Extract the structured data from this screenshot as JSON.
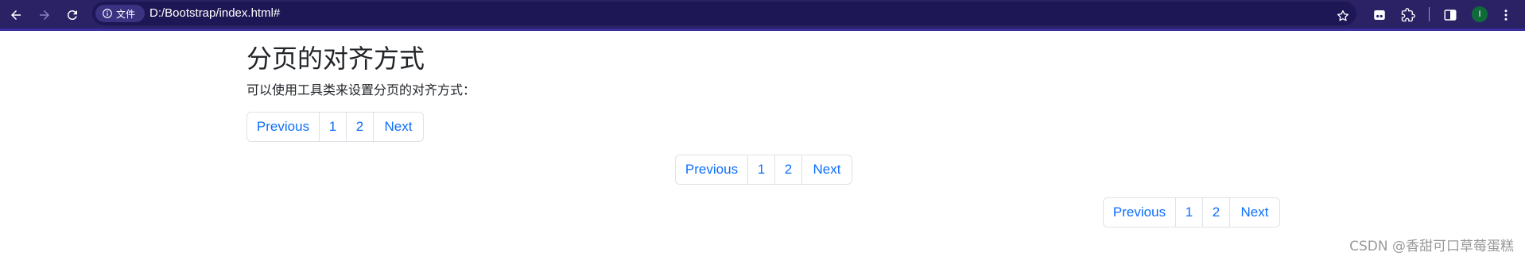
{
  "browser": {
    "site_chip_label": "文件",
    "url": "D:/Bootstrap/index.html#",
    "profile_initial": "I"
  },
  "page": {
    "title": "分页的对齐方式",
    "description": "可以使用工具类来设置分页的对齐方式："
  },
  "paginations": [
    {
      "alignment": "start",
      "items": [
        "Previous",
        "1",
        "2",
        "Next"
      ]
    },
    {
      "alignment": "center",
      "items": [
        "Previous",
        "1",
        "2",
        "Next"
      ]
    },
    {
      "alignment": "end",
      "items": [
        "Previous",
        "1",
        "2",
        "Next"
      ]
    }
  ],
  "watermark": "CSDN @香甜可口草莓蛋糕",
  "colors": {
    "toolbar_bg": "#2b2266",
    "link": "#0d6efd",
    "border": "#dee2e6",
    "text": "#212529"
  }
}
